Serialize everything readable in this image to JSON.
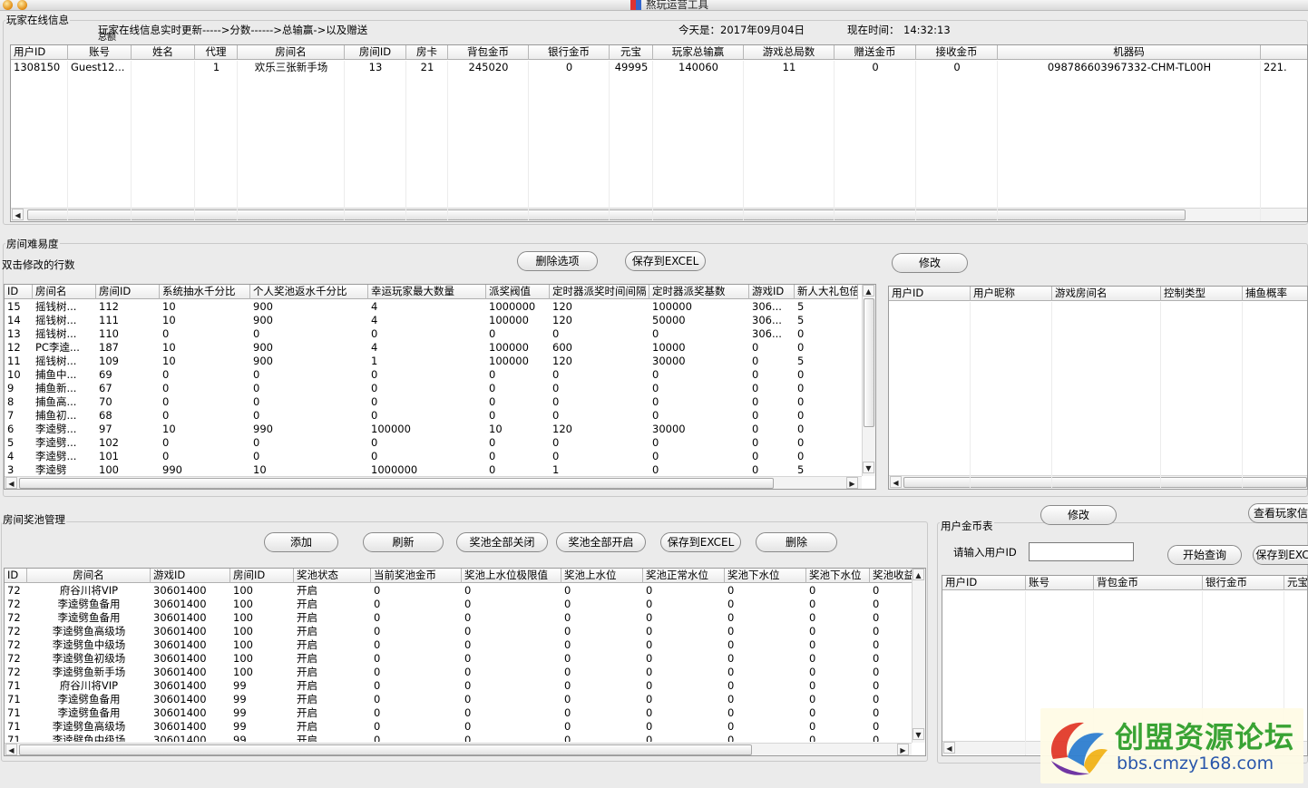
{
  "window": {
    "title": "熬玩运营工具"
  },
  "online": {
    "group_label": "玩家在线信息",
    "hint_line1": "玩家在线信息实时更新----->分数------>总输赢->以及赠送",
    "hint_line2": "总额",
    "date_text": "今天是：2017年09月04日",
    "time_label": "现在时间：",
    "time_value": "14:32:13",
    "columns": [
      "用户ID",
      "账号",
      "姓名",
      "代理",
      "房间名",
      "房间ID",
      "房卡",
      "背包金币",
      "银行金币",
      "元宝",
      "玩家总输赢",
      "游戏总局数",
      "赠送金币",
      "接收金币",
      "机器码",
      ""
    ],
    "rows": [
      [
        "1308150",
        "Guest12...",
        "",
        "1",
        "欢乐三张新手场",
        "13",
        "21",
        "245020",
        "0",
        "49995",
        "140060",
        "11",
        "0",
        "0",
        "098786603967332-CHM-TL00H",
        "221."
      ]
    ]
  },
  "difficulty": {
    "group_label": "房间难易度",
    "note": "双击修改的行数",
    "delete_btn": "删除选项",
    "excel_btn": "保存到EXCEL",
    "columns": [
      "ID",
      "房间名",
      "房间ID",
      "系统抽水千分比",
      "个人奖池返水千分比",
      "幸运玩家最大数量",
      "派奖阀值",
      "定时器派奖时间间隔",
      "定时器派奖基数",
      "游戏ID",
      "新人大礼包倍"
    ],
    "rows": [
      [
        "15",
        "摇钱树...",
        "112",
        "10",
        "900",
        "4",
        "1000000",
        "120",
        "100000",
        "306...",
        "5"
      ],
      [
        "14",
        "摇钱树...",
        "111",
        "10",
        "900",
        "4",
        "100000",
        "120",
        "50000",
        "306...",
        "5"
      ],
      [
        "13",
        "摇钱树...",
        "110",
        "0",
        "0",
        "0",
        "0",
        "0",
        "0",
        "306...",
        "0"
      ],
      [
        "12",
        "PC李逵...",
        "187",
        "10",
        "900",
        "4",
        "100000",
        "600",
        "10000",
        "0",
        "0"
      ],
      [
        "11",
        "摇钱树...",
        "109",
        "10",
        "900",
        "1",
        "100000",
        "120",
        "30000",
        "0",
        "5"
      ],
      [
        "10",
        "捕鱼中...",
        "69",
        "0",
        "0",
        "0",
        "0",
        "0",
        "0",
        "0",
        "0"
      ],
      [
        "9",
        "捕鱼新...",
        "67",
        "0",
        "0",
        "0",
        "0",
        "0",
        "0",
        "0",
        "0"
      ],
      [
        "8",
        "捕鱼高...",
        "70",
        "0",
        "0",
        "0",
        "0",
        "0",
        "0",
        "0",
        "0"
      ],
      [
        "7",
        "捕鱼初...",
        "68",
        "0",
        "0",
        "0",
        "0",
        "0",
        "0",
        "0",
        "0"
      ],
      [
        "6",
        "李逵劈...",
        "97",
        "10",
        "990",
        "100000",
        "10",
        "120",
        "30000",
        "0",
        "0"
      ],
      [
        "5",
        "李逵劈...",
        "102",
        "0",
        "0",
        "0",
        "0",
        "0",
        "0",
        "0",
        "0"
      ],
      [
        "4",
        "李逵劈...",
        "101",
        "0",
        "0",
        "0",
        "0",
        "0",
        "0",
        "0",
        "0"
      ],
      [
        "3",
        "李逵劈",
        "100",
        "990",
        "10",
        "1000000",
        "0",
        "1",
        "0",
        "0",
        "5"
      ]
    ]
  },
  "control": {
    "modify_btn": "修改",
    "columns": [
      "用户ID",
      "用户昵称",
      "游戏房间名",
      "控制类型",
      "捕鱼概率"
    ]
  },
  "pool": {
    "group_label": "房间奖池管理",
    "buttons": {
      "add": "添加",
      "refresh": "刷新",
      "close_all": "奖池全部关闭",
      "open_all": "奖池全部开启",
      "excel": "保存到EXCEL",
      "delete": "删除"
    },
    "columns": [
      "ID",
      "房间名",
      "游戏ID",
      "房间ID",
      "奖池状态",
      "当前奖池金币",
      "奖池上水位极限值",
      "奖池上水位",
      "奖池正常水位",
      "奖池下水位",
      "奖池下水位",
      "奖池收益"
    ],
    "rows": [
      [
        "72",
        "府谷川将VIP",
        "30601400",
        "100",
        "开启",
        "0",
        "0",
        "0",
        "0",
        "0",
        "0",
        "0"
      ],
      [
        "72",
        "李逵劈鱼备用",
        "30601400",
        "100",
        "开启",
        "0",
        "0",
        "0",
        "0",
        "0",
        "0",
        "0"
      ],
      [
        "72",
        "李逵劈鱼备用",
        "30601400",
        "100",
        "开启",
        "0",
        "0",
        "0",
        "0",
        "0",
        "0",
        "0"
      ],
      [
        "72",
        "李逵劈鱼高级场",
        "30601400",
        "100",
        "开启",
        "0",
        "0",
        "0",
        "0",
        "0",
        "0",
        "0"
      ],
      [
        "72",
        "李逵劈鱼中级场",
        "30601400",
        "100",
        "开启",
        "0",
        "0",
        "0",
        "0",
        "0",
        "0",
        "0"
      ],
      [
        "72",
        "李逵劈鱼初级场",
        "30601400",
        "100",
        "开启",
        "0",
        "0",
        "0",
        "0",
        "0",
        "0",
        "0"
      ],
      [
        "72",
        "李逵劈鱼新手场",
        "30601400",
        "100",
        "开启",
        "0",
        "0",
        "0",
        "0",
        "0",
        "0",
        "0"
      ],
      [
        "71",
        "府谷川将VIP",
        "30601400",
        "99",
        "开启",
        "0",
        "0",
        "0",
        "0",
        "0",
        "0",
        "0"
      ],
      [
        "71",
        "李逵劈鱼备用",
        "30601400",
        "99",
        "开启",
        "0",
        "0",
        "0",
        "0",
        "0",
        "0",
        "0"
      ],
      [
        "71",
        "李逵劈鱼备用",
        "30601400",
        "99",
        "开启",
        "0",
        "0",
        "0",
        "0",
        "0",
        "0",
        "0"
      ],
      [
        "71",
        "李逵劈鱼高级场",
        "30601400",
        "99",
        "开启",
        "0",
        "0",
        "0",
        "0",
        "0",
        "0",
        "0"
      ],
      [
        "71",
        "李逵劈鱼中级场",
        "30601400",
        "99",
        "开启",
        "0",
        "0",
        "0",
        "0",
        "0",
        "0",
        "0"
      ]
    ]
  },
  "user_gold": {
    "group_label": "用户金币表",
    "modify_btn": "修改",
    "view_btn": "查看玩家信",
    "input_label": "请输入用户ID",
    "input_value": "",
    "query_btn": "开始查询",
    "excel_btn": "保存到EXC",
    "columns": [
      "用户ID",
      "账号",
      "背包金币",
      "银行金币",
      "元宝"
    ]
  },
  "watermark": {
    "cn": "创盟资源论坛",
    "url": "bbs.cmzy168.com"
  },
  "colors": {
    "bg": "#ebebeb",
    "grid_bg": "#ffffff",
    "wm_green": "#2f9f2a",
    "wm_blue": "#1f4fa8"
  }
}
